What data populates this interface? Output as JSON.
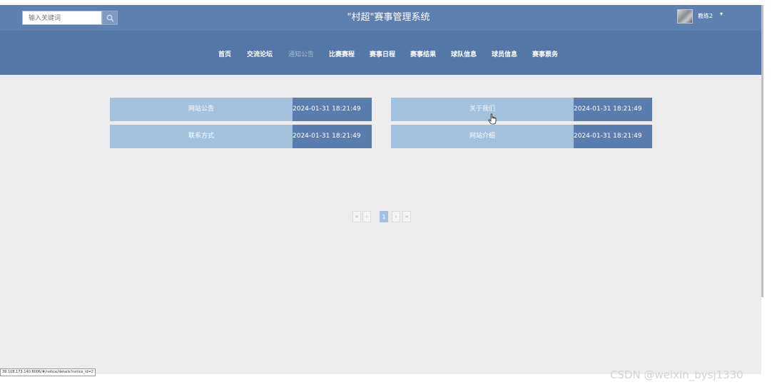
{
  "header": {
    "search_placeholder": "输入关键词",
    "app_title": "\"村超\"赛事管理系统",
    "username": "教练2",
    "caret": "▾"
  },
  "nav": [
    {
      "label": "首页",
      "active": false
    },
    {
      "label": "交流论坛",
      "active": false
    },
    {
      "label": "通知公告",
      "active": true
    },
    {
      "label": "比赛赛程",
      "active": false
    },
    {
      "label": "赛事日程",
      "active": false
    },
    {
      "label": "赛事结果",
      "active": false
    },
    {
      "label": "球队信息",
      "active": false
    },
    {
      "label": "球员信息",
      "active": false
    },
    {
      "label": "赛事票务",
      "active": false
    }
  ],
  "notices": [
    {
      "title": "网站公告",
      "date": "2024-01-31 18:21:49"
    },
    {
      "title": "关于我们",
      "date": "2024-01-31 18:21:49"
    },
    {
      "title": "联系方式",
      "date": "2024-01-31 18:21:49"
    },
    {
      "title": "网站介绍",
      "date": "2024-01-31 18:21:49"
    }
  ],
  "pagination": {
    "first": "«",
    "prev": "‹",
    "current": "1",
    "next": "›",
    "last": "»"
  },
  "status_url": "39.108.173.140:8006/#/notice/details?notice_id=2",
  "watermark": "CSDN @weixin_bysj1330",
  "colors": {
    "header": "#5577a8",
    "card_title": "#a4c1dd",
    "card_date": "#5a7db0",
    "background": "#ececec"
  }
}
